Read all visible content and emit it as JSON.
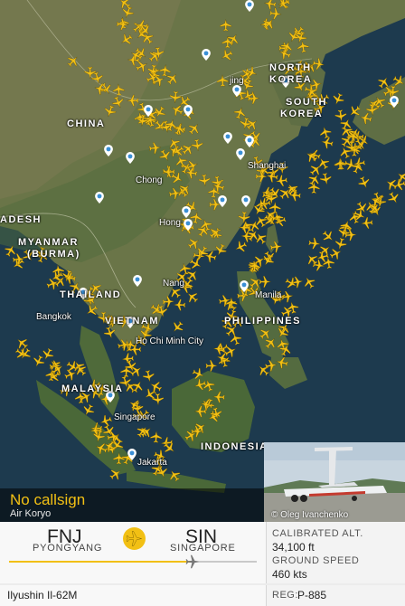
{
  "map": {
    "countries": [
      "NORTH",
      "KOREA",
      "CHINA",
      "SOUTH",
      "KOREA",
      "ADESH",
      "MYANMAR",
      "(BURMA)",
      "THAILAND",
      "VIETNAM",
      "PHILIPPINES",
      "MALAYSIA",
      "INDONESIA"
    ],
    "cities": [
      "jing",
      "Shanghai",
      "Chong",
      "Hong",
      "Nang",
      "Manila",
      "Bangkok",
      "Ho Chi Minh City",
      "Singapore",
      "Jakarta"
    ]
  },
  "flight": {
    "callsign": "No callsign",
    "airline": "Air Koryo",
    "origin_code": "FNJ",
    "origin_city": "PYONGYANG",
    "dest_code": "SIN",
    "dest_city": "SINGAPORE",
    "progress": 0.74
  },
  "stats": {
    "alt_label": "CALIBRATED ALT.",
    "alt_value": "34,100 ft",
    "speed_label": "GROUND SPEED",
    "speed_value": "460 kts"
  },
  "aircraft": {
    "type": "Ilyushin Il-62M",
    "reg_label": "REG:",
    "reg_value": "P-885"
  },
  "photo": {
    "credit": "© Oleg Ivanchenko"
  },
  "colors": {
    "accent": "#f2c014",
    "ocean": "#1d3a4e",
    "land": "#6a7548"
  },
  "icons": {
    "route": "airplane-icon",
    "progress": "airplane-icon",
    "pin": "map-pin-icon"
  }
}
